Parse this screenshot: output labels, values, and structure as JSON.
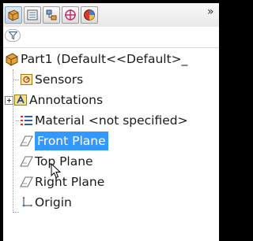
{
  "tabs": [
    {
      "name": "featuremanager-tab-icon",
      "active": true
    },
    {
      "name": "propertymanager-tab-icon",
      "active": false
    },
    {
      "name": "configurationmanager-tab-icon",
      "active": false
    },
    {
      "name": "dimxpert-tab-icon",
      "active": false
    },
    {
      "name": "display-manager-tab-icon",
      "active": false
    }
  ],
  "tab_more_glyph": "»",
  "filter_icon": "filter-icon",
  "tree": {
    "root": {
      "label": "Part1  (Default<<Default>_",
      "icon": "part-icon"
    },
    "items": [
      {
        "label": "Sensors",
        "icon": "sensors-icon"
      },
      {
        "label": "Annotations",
        "icon": "annotations-icon",
        "expander": "+"
      },
      {
        "label": "Material <not specified>",
        "icon": "material-icon"
      },
      {
        "label": "Front Plane",
        "icon": "plane-icon",
        "selected": true
      },
      {
        "label": "Top Plane",
        "icon": "plane-icon"
      },
      {
        "label": "Right Plane",
        "icon": "plane-icon"
      },
      {
        "label": "Origin",
        "icon": "origin-icon"
      }
    ]
  },
  "colors": {
    "selection": "#3399ff",
    "part_icon": "#d8902a"
  }
}
